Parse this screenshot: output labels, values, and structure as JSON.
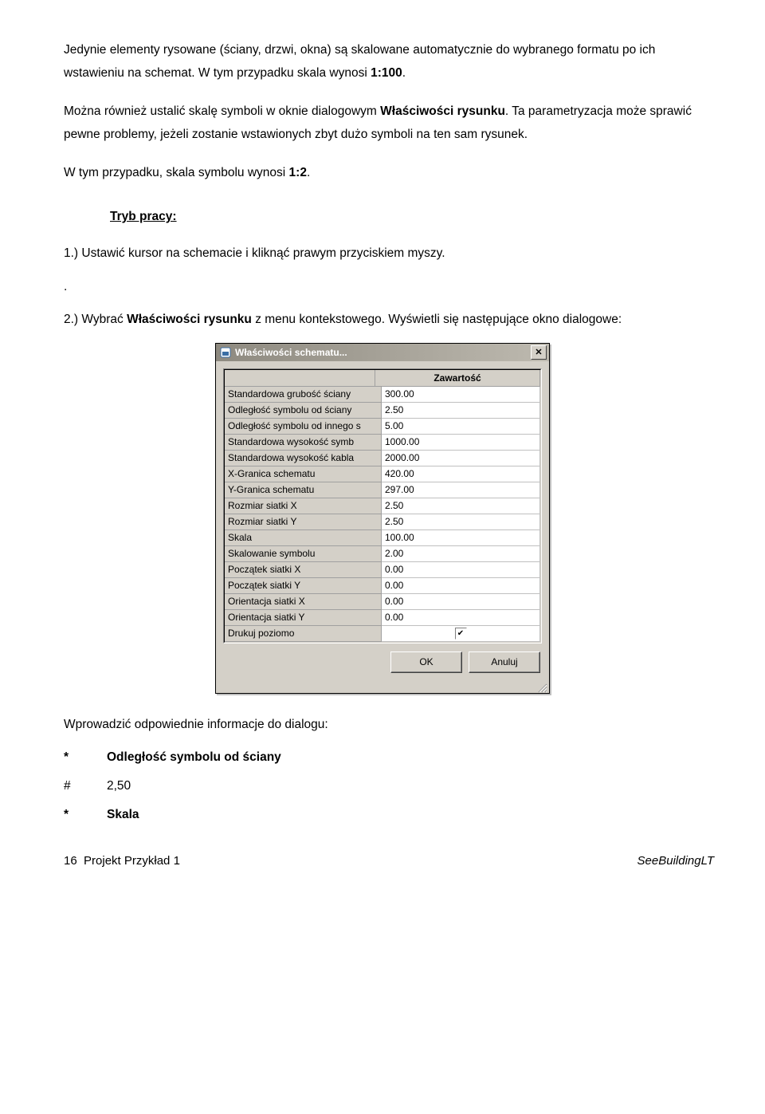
{
  "paragraphs": {
    "p1_a": "Jedynie elementy rysowane (ściany, drzwi, okna) są skalowane automatycznie do wybranego formatu po ich wstawieniu na schemat. W tym przypadku skala wynosi ",
    "p1_b": "1:100",
    "p1_c": ".",
    "p2_a": "Można również ustalić skalę symboli w oknie dialogowym ",
    "p2_b": "Właściwości rysunku",
    "p2_c": ". Ta parametryzacja może sprawić pewne problemy, jeżeli zostanie wstawionych zbyt dużo symboli na ten sam rysunek.",
    "p3_a": "W tym przypadku, skala symbolu wynosi ",
    "p3_b": "1:2",
    "p3_c": ".",
    "heading": "Tryb pracy:",
    "step1": "1.) Ustawić kursor na schemacie i kliknąć prawym przyciskiem myszy.",
    "dot": ".",
    "step2_a": "2.) Wybrać ",
    "step2_b": "Właściwości rysunku",
    "step2_c": " z menu kontekstowego. Wyświetli się następujące okno dialogowe:",
    "after_dialog": "Wprowadzić odpowiednie informacje do dialogu:",
    "def1_mark": "*",
    "def1_text": "Odległość symbolu od ściany",
    "def2_mark": "#",
    "def2_text": "2,50",
    "def3_mark": "*",
    "def3_text": "Skala"
  },
  "dialog": {
    "title": "Właściwości schematu...",
    "header": "Zawartość",
    "rows": [
      {
        "label": "Standardowa grubość ściany",
        "value": "300.00"
      },
      {
        "label": "Odległość symbolu od ściany",
        "value": "2.50"
      },
      {
        "label": "Odległość symbolu od innego s",
        "value": "5.00"
      },
      {
        "label": "Standardowa wysokość symb",
        "value": "1000.00"
      },
      {
        "label": "Standardowa wysokość kabla",
        "value": "2000.00"
      },
      {
        "label": "X-Granica schematu",
        "value": "420.00"
      },
      {
        "label": "Y-Granica schematu",
        "value": "297.00"
      },
      {
        "label": "Rozmiar siatki X",
        "value": "2.50"
      },
      {
        "label": "Rozmiar siatki Y",
        "value": "2.50"
      },
      {
        "label": "Skala",
        "value": "100.00"
      },
      {
        "label": "Skalowanie symbolu",
        "value": "2.00"
      },
      {
        "label": "Początek siatki X",
        "value": "0.00"
      },
      {
        "label": "Początek siatki Y",
        "value": "0.00"
      },
      {
        "label": "Orientacja siatki X",
        "value": "0.00"
      },
      {
        "label": "Orientacja siatki Y",
        "value": "0.00"
      },
      {
        "label": "Drukuj poziomo",
        "value": "__checkbox__"
      }
    ],
    "buttons": {
      "ok": "OK",
      "cancel": "Anuluj"
    }
  },
  "footer": {
    "left_a": "16",
    "left_b": "Projekt Przykład 1",
    "right": "SeeBuildingLT"
  }
}
